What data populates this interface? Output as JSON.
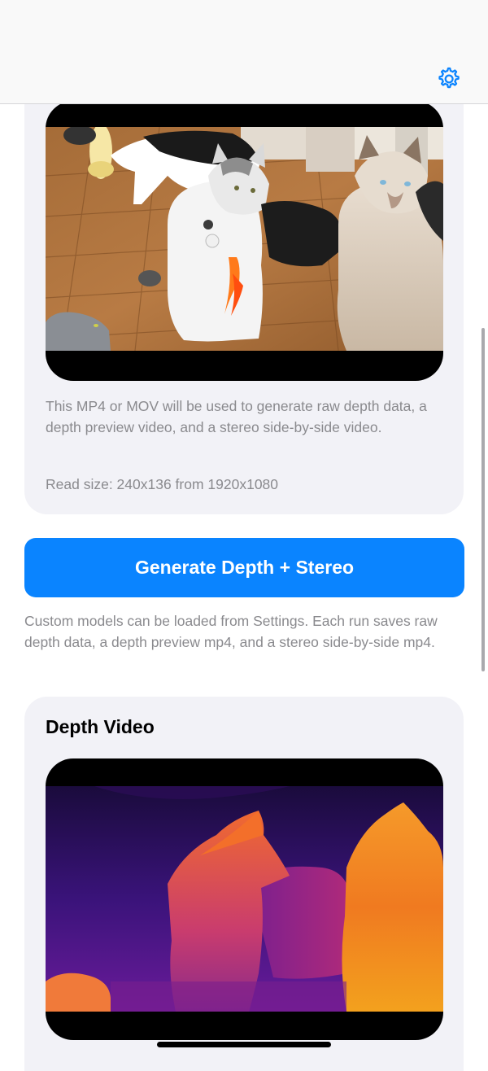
{
  "nav": {
    "settings_icon": "gear-icon",
    "accent_color": "#0a84ff"
  },
  "input_card": {
    "video_thumbnail": "cats-video-frame",
    "description": "This MP4 or MOV will be used to generate raw depth data, a depth preview video, and a stereo side-by-side video.",
    "read_size": "Read size: 240x136 from 1920x1080"
  },
  "generate_button": {
    "label": "Generate Depth + Stereo"
  },
  "footnote": "Custom models can be loaded from Settings. Each run saves raw depth data, a depth preview mp4, and a stereo side-by-side mp4.",
  "depth_card": {
    "title": "Depth Video",
    "video_thumbnail": "depth-heatmap-frame"
  },
  "colors": {
    "card_background": "#f2f2f7",
    "secondary_text": "#8a8a8e",
    "button_background": "#0a84ff"
  }
}
